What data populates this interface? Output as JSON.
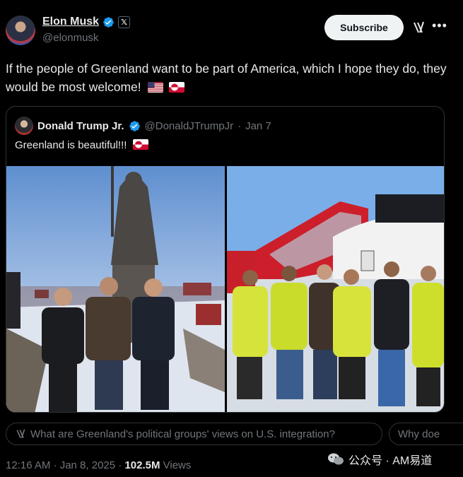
{
  "author": {
    "name": "Elon Musk",
    "handle": "@elonmusk"
  },
  "header": {
    "subscribe_label": "Subscribe",
    "x_badge": "𝕏"
  },
  "post": {
    "text": "If the people of Greenland want to be part of America, which I hope they do, they would be most welcome!",
    "flags": [
      "us-flag",
      "greenland-flag"
    ]
  },
  "quote": {
    "name": "Donald Trump Jr.",
    "handle": "@DonaldJTrumpJr",
    "separator": "·",
    "date": "Jan 7",
    "text": "Greenland is beautiful!!!"
  },
  "grok_suggestions": [
    "What are Greenland's political groups' views on U.S. integration?",
    "Why doe"
  ],
  "footer": {
    "time": "12:16 AM · Jan 8, 2025 · ",
    "views_count": "102.5M",
    "views_label": " Views"
  },
  "watermark": {
    "text": "公众号 · AM易道"
  },
  "colors": {
    "background": "#000000",
    "text": "#e7e9ea",
    "muted": "#71767b",
    "verified": "#1d9bf0",
    "border": "#2f3336"
  }
}
